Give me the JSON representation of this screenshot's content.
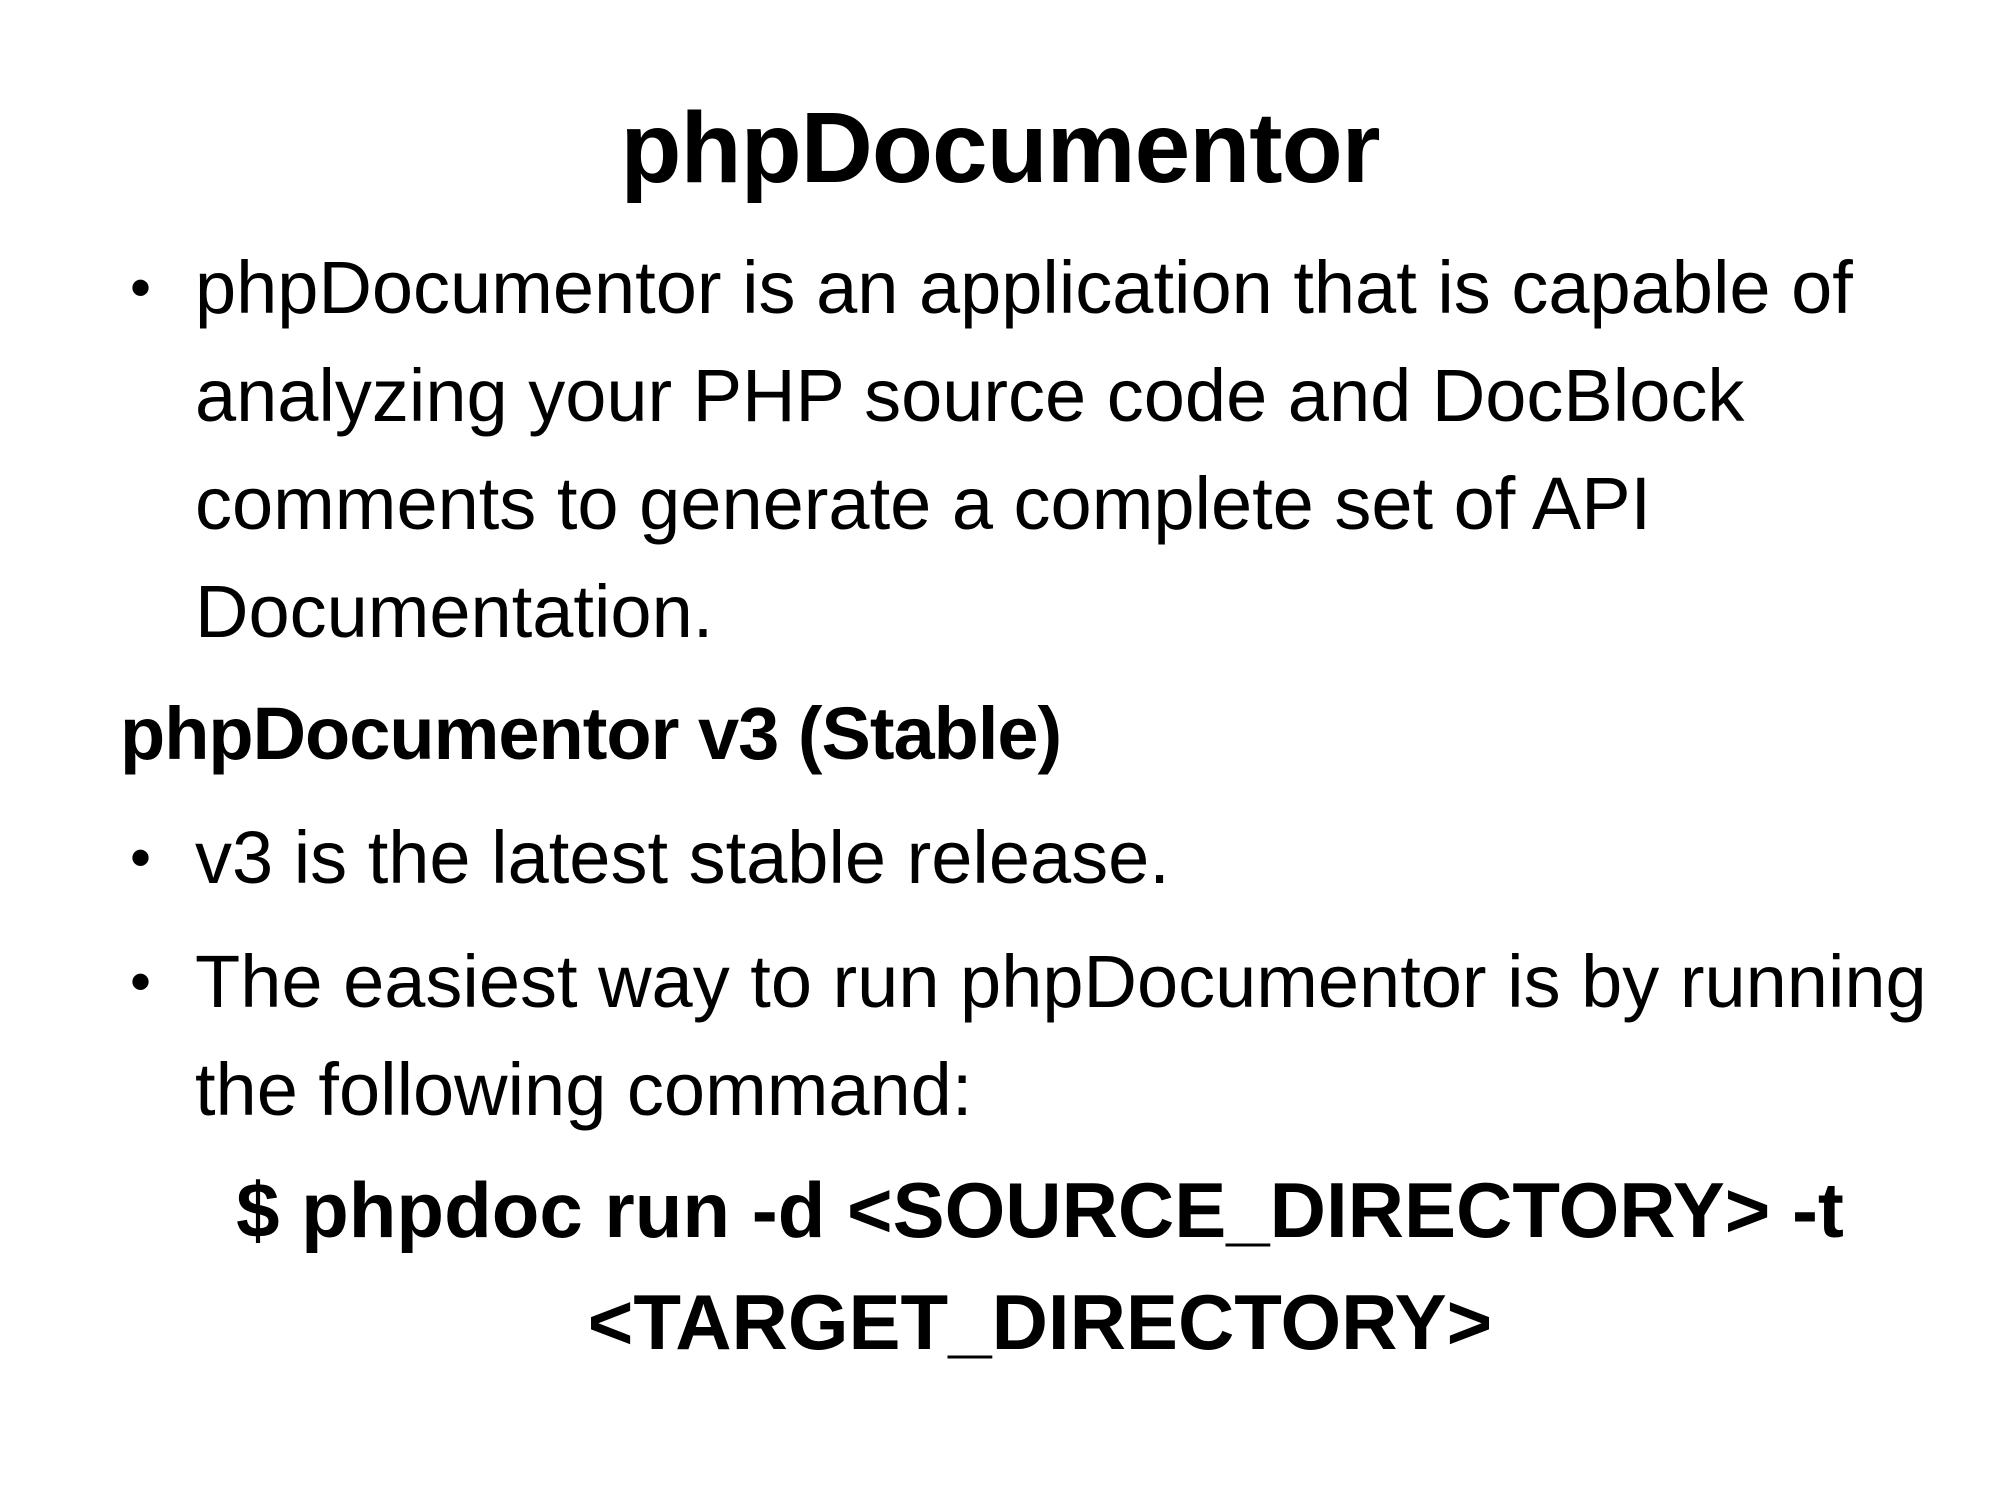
{
  "slide": {
    "title": "phpDocumentor",
    "bullets_intro": [
      {
        "text": "phpDocumentor is an application that is capable of analyzing your PHP source code and DocBlock comments to generate a complete set of API Documentation."
      }
    ],
    "subheading": "phpDocumentor v3 (Stable)",
    "bullets_v3": [
      {
        "text": "v3 is the latest stable release."
      },
      {
        "text": "The easiest way to run phpDocumentor is by running the following command:"
      }
    ],
    "command": "$ phpdoc run -d <SOURCE_DIRECTORY> -t <TARGET_DIRECTORY>",
    "bullet_glyph": "•"
  }
}
